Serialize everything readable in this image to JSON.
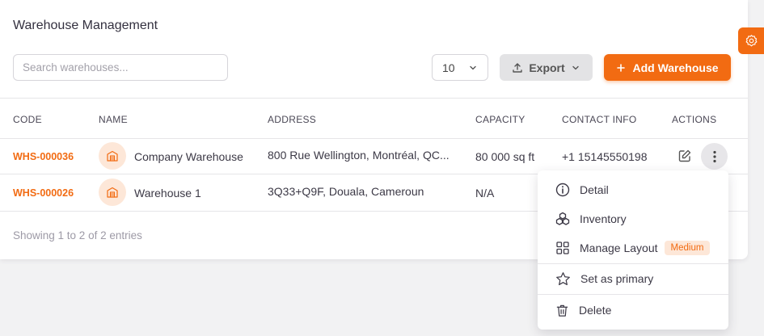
{
  "page": {
    "title": "Warehouse Management"
  },
  "toolbar": {
    "search_placeholder": "Search warehouses...",
    "per_page": "10",
    "export_label": "Export",
    "add_label": "Add Warehouse"
  },
  "table": {
    "headers": [
      "CODE",
      "NAME",
      "ADDRESS",
      "CAPACITY",
      "CONTACT INFO",
      "ACTIONS"
    ],
    "rows": [
      {
        "code": "WHS-000036",
        "name": "Company Warehouse",
        "address": "800 Rue Wellington, Montréal, QC...",
        "capacity": "80 000 sq ft",
        "contact": "+1 15145550198"
      },
      {
        "code": "WHS-000026",
        "name": "Warehouse 1",
        "address": "3Q33+Q9F, Douala, Cameroun",
        "capacity": "N/A",
        "contact": ""
      }
    ],
    "footer": "Showing 1 to 2 of 2 entries"
  },
  "menu": {
    "detail": "Detail",
    "inventory": "Inventory",
    "manage_layout": "Manage Layout",
    "manage_layout_badge": "Medium",
    "set_primary": "Set as primary",
    "delete": "Delete"
  },
  "colors": {
    "accent": "#f26b12",
    "accent_light": "#fde7d8"
  },
  "icons": [
    "settings-icon",
    "upload-icon",
    "chevron-down-icon",
    "plus-icon",
    "warehouse-icon",
    "edit-icon",
    "more-vertical-icon",
    "info-icon",
    "boxes-icon",
    "grid-icon",
    "star-icon",
    "trash-icon"
  ]
}
